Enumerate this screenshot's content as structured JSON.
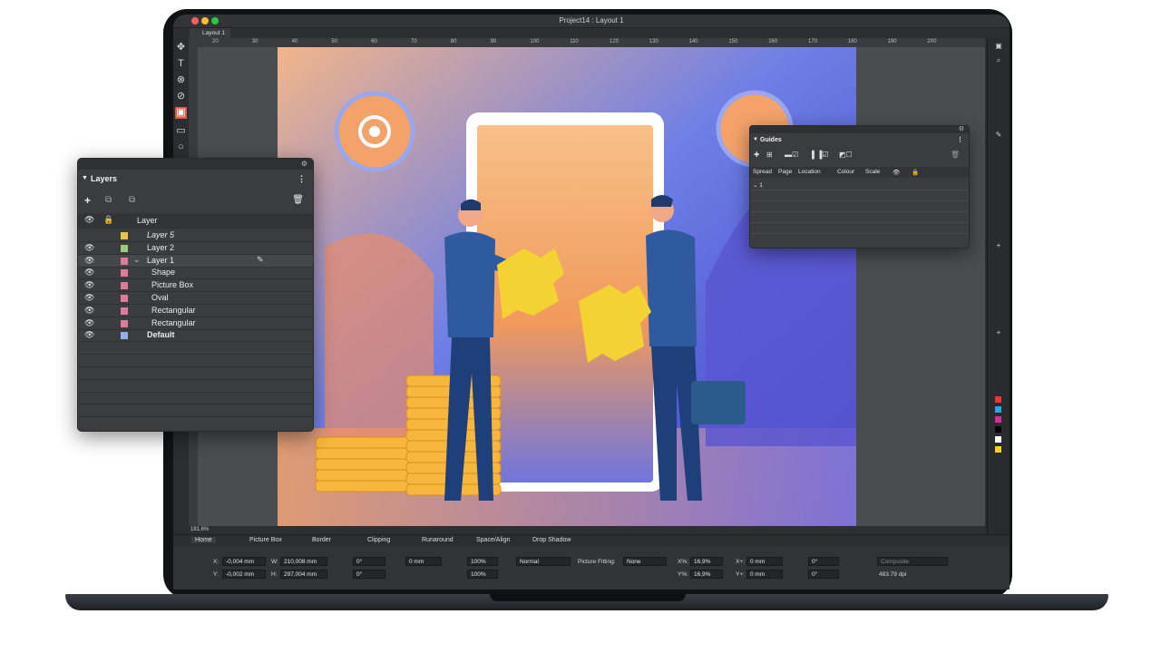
{
  "window": {
    "title": "Project14 : Layout 1",
    "tab": "Layout 1"
  },
  "ruler": {
    "top_ticks": [
      "20",
      "30",
      "40",
      "50",
      "60",
      "70",
      "80",
      "90",
      "100",
      "110",
      "120",
      "130",
      "140",
      "150",
      "160",
      "170",
      "180",
      "190",
      "200"
    ]
  },
  "status": {
    "zoom": "181,6%"
  },
  "props": {
    "tabs": [
      "Home",
      "Picture Box",
      "Border",
      "Clipping",
      "Runaround",
      "Space/Align",
      "Drop Shadow"
    ],
    "x_label": "X:",
    "x_value": "-0,004 mm",
    "y_label": "Y:",
    "y_value": "-0,002 mm",
    "w_label": "W:",
    "w_value": "210,008 mm",
    "h_label": "H:",
    "h_value": "297,004 mm",
    "angle1": "0°",
    "angle2": "0°",
    "corner": "0 mm",
    "skew": "0°",
    "opacity1": "100%",
    "opacity2": "100%",
    "blend": "Normal",
    "fitting_label": "Picture Fitting:",
    "fitting_value": "None",
    "xpct_label": "X%:",
    "xpct_value": "16,9%",
    "ypct_label": "Y%:",
    "ypct_value": "16,9%",
    "xplus_label": "X+:",
    "xplus_value": "0 mm",
    "yplus_label": "Y+:",
    "yplus_value": "0 mm",
    "angle3": "0°",
    "angle4": "0°",
    "composite": "Composite",
    "dpi": "483.79 dpi"
  },
  "layers": {
    "title": "Layers",
    "header_label": "Layer",
    "rows": [
      {
        "name": "Layer 5",
        "color": "#e6c64a",
        "eye": false,
        "italic": true,
        "indent": 0
      },
      {
        "name": "Layer 2",
        "color": "#9acd7a",
        "eye": true,
        "italic": false,
        "indent": 0
      },
      {
        "name": "Layer 1",
        "color": "#e07a9a",
        "eye": true,
        "italic": false,
        "indent": 0
      },
      {
        "name": "Shape",
        "color": "#e07a9a",
        "eye": true,
        "italic": false,
        "indent": 1
      },
      {
        "name": "Picture Box",
        "color": "#e07a9a",
        "eye": true,
        "italic": false,
        "indent": 1
      },
      {
        "name": "Oval",
        "color": "#e07a9a",
        "eye": true,
        "italic": false,
        "indent": 1
      },
      {
        "name": "Rectangular",
        "color": "#e07a9a",
        "eye": true,
        "italic": false,
        "indent": 1
      },
      {
        "name": "Rectangular",
        "color": "#e07a9a",
        "eye": true,
        "italic": false,
        "indent": 1
      },
      {
        "name": "Default",
        "color": "#8fb0e8",
        "eye": true,
        "italic": false,
        "indent": 0
      }
    ]
  },
  "guides": {
    "title": "Guides",
    "columns": [
      "Spread",
      "Page",
      "Location",
      "Colour",
      "Scale"
    ],
    "first_row": "1"
  },
  "colors": {
    "accent": "#3f63d6",
    "orange": "#f39a4a"
  }
}
